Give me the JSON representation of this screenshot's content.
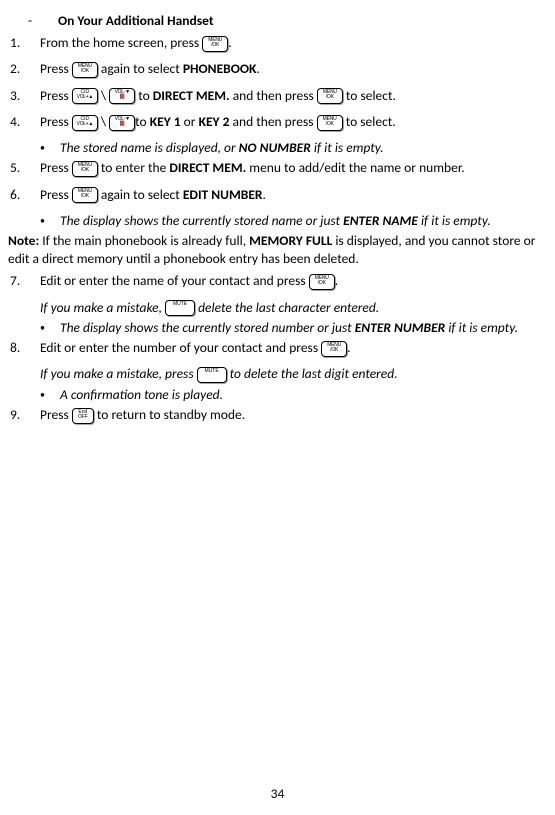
{
  "header": {
    "dash": "-",
    "title": "On Your Additional Handset"
  },
  "steps": {
    "s1": {
      "num": "1.",
      "a": "From the home screen, press ",
      "b": "."
    },
    "s2": {
      "num": "2.",
      "a": "Press ",
      "b": " again to select ",
      "c": "PHONEBOOK",
      "d": "."
    },
    "s3": {
      "num": "3.",
      "a": "Press ",
      "slash": " \\ ",
      "b": " to ",
      "c": "DIRECT MEM.",
      "d": " and then press ",
      "e": "  to select."
    },
    "s4": {
      "num": "4.",
      "a": "Press ",
      "slash": " \\ ",
      "b": "to ",
      "c": "KEY 1",
      "or": " or ",
      "c2": "KEY 2",
      "d": " and then press ",
      "e": " to select."
    },
    "s4_sub": {
      "a": "The stored name is displayed, or ",
      "b": "NO NUMBER",
      "c": " if it is empty."
    },
    "s5": {
      "num": "5.",
      "a": "Press ",
      "b": " to enter the ",
      "c": "DIRECT MEM.",
      "d": " menu to add/edit the name or number."
    },
    "s6": {
      "num": "6.",
      "a": "Press ",
      "b": " again to select ",
      "c": "EDIT NUMBER",
      "d": "."
    },
    "s6_sub": {
      "a": "The display shows the currently stored name or just ",
      "b": "ENTER NAME",
      "c": " if it is empty."
    },
    "s7": {
      "num": "7.",
      "a": "Edit or enter the name of your contact and press ",
      "b": "."
    },
    "s7_mist": {
      "a": "If you make a mistake, ",
      "b": " delete the last character entered."
    },
    "s7_sub": {
      "a": "The display shows the currently stored number or just ",
      "b": "ENTER NUMBER",
      "c": " if it is empty."
    },
    "s8": {
      "num": "8.",
      "a": "Edit or enter the number of your contact and press ",
      "b": "."
    },
    "s8_mist": {
      "a": "If you make a mistake, press ",
      "b": " to delete the last digit entered."
    },
    "s8_sub": {
      "a": "A confirmation tone is played."
    },
    "s9": {
      "num": "9.",
      "a": "Press ",
      "b": " to return to standby mode."
    }
  },
  "note": {
    "label": "Note:",
    "a": " If the main phonebook is already full, ",
    "b": "MEMORY FULL",
    "c": " is displayed, and you cannot store or edit a direct memory until a phonebook entry has been deleted."
  },
  "page": "34"
}
